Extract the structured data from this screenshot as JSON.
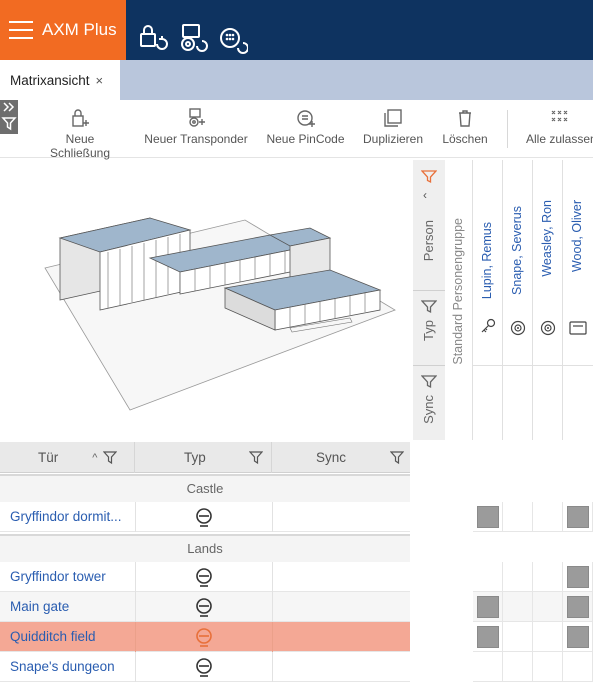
{
  "app": {
    "title": "AXM Plus"
  },
  "tab": {
    "label": "Matrixansicht",
    "close": "×"
  },
  "toolbar": {
    "new_lock": "Neue Schließung",
    "new_transponder": "Neuer Transponder",
    "new_pincode": "Neue PinCode",
    "duplicate": "Duplizieren",
    "delete": "Löschen",
    "allow_all": "Alle zulassen"
  },
  "filters": {
    "person": "Person",
    "typ": "Typ",
    "sync": "Sync"
  },
  "columns": {
    "group": "Standard Personengruppe",
    "persons": [
      {
        "name": "Lupin, Remus",
        "icon": "key-icon"
      },
      {
        "name": "Snape, Severus",
        "icon": "transponder-icon"
      },
      {
        "name": "Weasley, Ron",
        "icon": "transponder-icon"
      },
      {
        "name": "Wood, Oliver",
        "icon": "card-icon"
      }
    ]
  },
  "grid": {
    "headers": {
      "tuer": "Tür",
      "typ": "Typ",
      "sync": "Sync"
    },
    "groups": {
      "castle": "Castle",
      "lands": "Lands"
    },
    "rows": [
      {
        "name": "Gryffindor dormit...",
        "icon": "cylinder-icon",
        "selected": false
      },
      {
        "name": "Gryffindor tower",
        "icon": "cylinder-icon",
        "selected": false
      },
      {
        "name": "Main gate",
        "icon": "cylinder-icon",
        "selected": false
      },
      {
        "name": "Quidditch field",
        "icon": "cylinder-icon",
        "selected": true
      },
      {
        "name": "Snape's dungeon",
        "icon": "cylinder-icon",
        "selected": false
      }
    ],
    "authorizations": [
      [
        true,
        false,
        false,
        true
      ],
      [
        false,
        false,
        false,
        true
      ],
      [
        true,
        false,
        false,
        true
      ],
      [
        true,
        false,
        false,
        true
      ],
      [
        false,
        false,
        false,
        false
      ]
    ]
  },
  "colors": {
    "header": "#0e3360",
    "brand": "#f26b22",
    "tabstrip": "#b9c6dc",
    "selected_row": "#f4a895",
    "link": "#2a5db0"
  }
}
